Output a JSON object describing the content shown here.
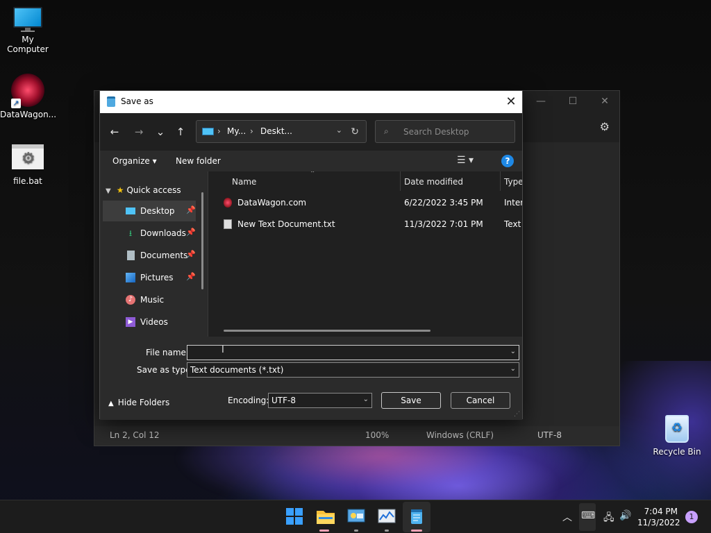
{
  "desktop": {
    "icons": [
      {
        "label": "My Computer"
      },
      {
        "label": "DataWagon..."
      },
      {
        "label": "file.bat"
      },
      {
        "label": "Recycle Bin"
      }
    ]
  },
  "notepad": {
    "status": {
      "position": "Ln 2, Col 12",
      "zoom": "100%",
      "line_endings": "Windows (CRLF)",
      "encoding": "UTF-8"
    },
    "controls": {
      "minimize": "—",
      "maximize": "☐",
      "close": "✕",
      "settings": "⚙"
    }
  },
  "dialog": {
    "title": "Save as",
    "close_glyph": "✕",
    "nav": {
      "back": "←",
      "forward": "→",
      "recent": "⌄",
      "up": "↑",
      "refresh": "↻"
    },
    "address": {
      "segments": [
        "My...",
        "Deskt..."
      ],
      "separator": "›"
    },
    "search_placeholder": "Search Desktop",
    "commands": {
      "organize": "Organize ▾",
      "new_folder": "New folder",
      "help": "?"
    },
    "nav_pane": {
      "quick_access": "Quick access",
      "items": [
        {
          "label": "Desktop",
          "icon": "desktop-icon",
          "pinned": true
        },
        {
          "label": "Downloads",
          "icon": "downloads-icon",
          "pinned": true
        },
        {
          "label": "Documents",
          "icon": "documents-icon",
          "pinned": true
        },
        {
          "label": "Pictures",
          "icon": "pictures-icon",
          "pinned": true
        },
        {
          "label": "Music",
          "icon": "music-icon",
          "pinned": false
        },
        {
          "label": "Videos",
          "icon": "videos-icon",
          "pinned": false
        }
      ]
    },
    "columns": {
      "name": "Name",
      "date": "Date modified",
      "type": "Type"
    },
    "files": [
      {
        "name": "DataWagon.com",
        "date": "6/22/2022 3:45 PM",
        "type": "Interr"
      },
      {
        "name": "New Text Document.txt",
        "date": "11/3/2022 7:01 PM",
        "type": "Text D"
      }
    ],
    "file_name_label": "File name:",
    "file_name_value": "",
    "save_type_label": "Save as type:",
    "save_type_value": "Text documents (*.txt)",
    "hide_folders": "Hide Folders",
    "encoding_label": "Encoding:",
    "encoding_value": "UTF-8",
    "save": "Save",
    "cancel": "Cancel"
  },
  "taskbar": {
    "time": "7:04 PM",
    "date": "11/3/2022",
    "notifications": "1"
  }
}
